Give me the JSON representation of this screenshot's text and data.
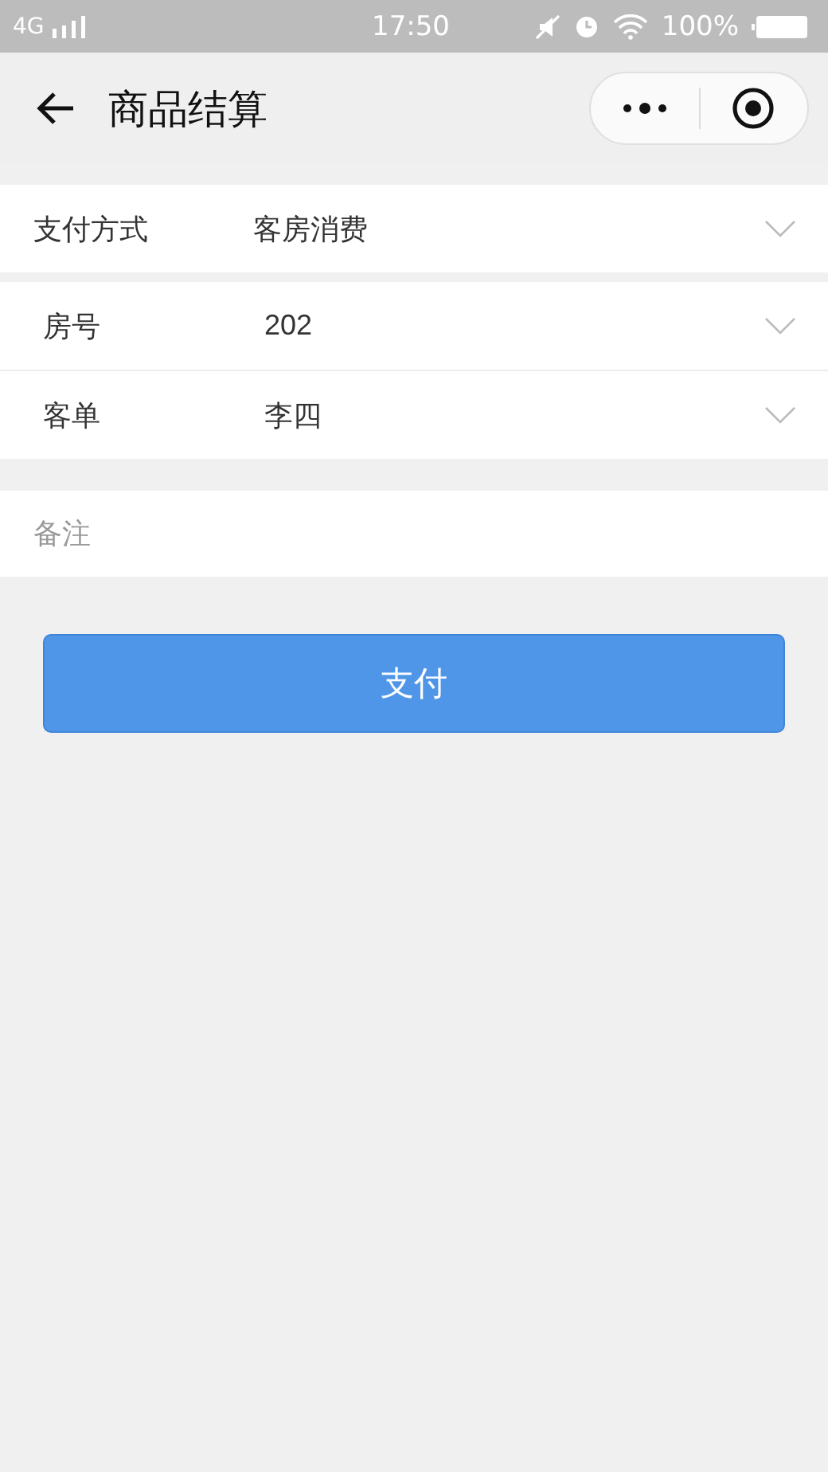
{
  "status_bar": {
    "network": "4G",
    "time": "17:50",
    "battery": "100%"
  },
  "nav": {
    "title": "商品结算"
  },
  "payment": {
    "label": "支付方式",
    "value": "客房消费"
  },
  "details": [
    {
      "label": "房号",
      "value": "202"
    },
    {
      "label": "客单",
      "value": "李四"
    }
  ],
  "remark": {
    "placeholder": "备注"
  },
  "submit": "支付"
}
